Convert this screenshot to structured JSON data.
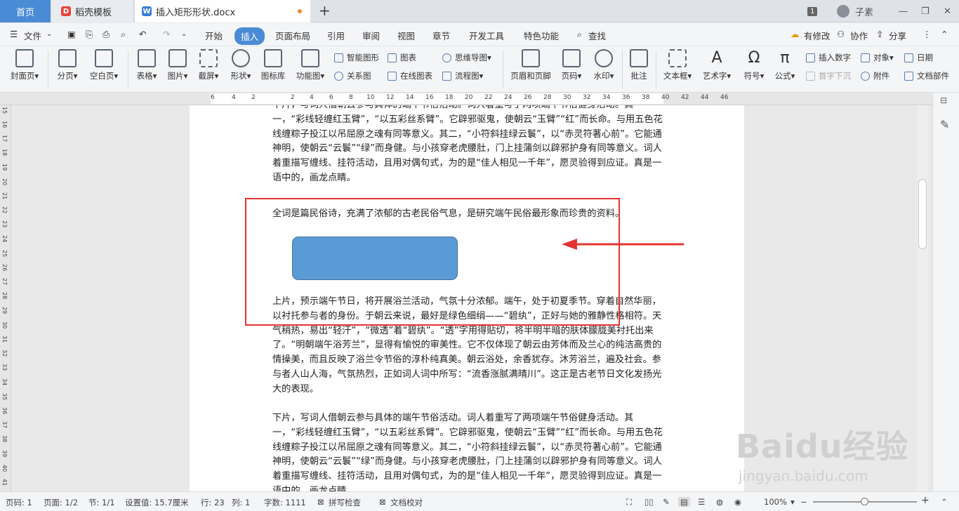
{
  "tabs": {
    "home": "首页",
    "template": "稻壳模板",
    "doc": "插入矩形形状.docx",
    "new": "+"
  },
  "window": {
    "badge": "1",
    "user": "子素"
  },
  "menu": {
    "file": "文件",
    "items": [
      "开始",
      "插入",
      "页面布局",
      "引用",
      "审阅",
      "视图",
      "章节",
      "开发工具",
      "特色功能"
    ],
    "search": "查找",
    "right": [
      "有修改",
      "协作",
      "分享"
    ]
  },
  "ribbon": {
    "cover": "封面页",
    "pagebreak": "分页",
    "blank": "空白页",
    "table": "表格",
    "picture": "图片",
    "screenshot": "截屏",
    "shape": "形状",
    "iconlib": "图标库",
    "funcchart": "功能图",
    "smartart": "智能图形",
    "chart": "图表",
    "mindmap": "思维导图",
    "relation": "关系图",
    "onlinechart": "在线图表",
    "flowchart": "流程图",
    "headerfooter": "页眉和页脚",
    "pagenum": "页码",
    "watermark": "水印",
    "comment": "批注",
    "textbox": "文本框",
    "wordart": "艺术字",
    "symbol": "符号",
    "formula": "公式",
    "insertnum": "插入数字",
    "object": "对象",
    "date": "日期",
    "dropcap": "首字下沉",
    "attachment": "附件",
    "docpart": "文档部件"
  },
  "ruler": {
    "h": [
      "6",
      "4",
      "2",
      "2",
      "4",
      "6",
      "8",
      "10",
      "12",
      "14",
      "16",
      "18",
      "20",
      "22",
      "24",
      "26",
      "28",
      "30",
      "32",
      "34",
      "36",
      "38",
      "40",
      "42",
      "44",
      "46"
    ],
    "v": [
      "15",
      "16",
      "17",
      "18",
      "19",
      "20",
      "21",
      "22",
      "23",
      "24",
      "25",
      "26",
      "27",
      "28",
      "29",
      "30",
      "31",
      "32",
      "33",
      "34",
      "35",
      "36",
      "37",
      "38",
      "39",
      "40",
      "41"
    ]
  },
  "doc": {
    "p0": "下片，写词人借朝云参与具体的端午节俗活动。词人着重写了两项端午节俗健身活动。其一，“彩线轻缠红玉臂”，“以五彩丝系臂”。它辟邪驱鬼，使朝云“玉臂”“红”而长命。与用五色花线缠粽子投江以吊屈原之魂有同等意义。其二，“小符斜挂绿云鬟”，以“赤灵符著心前”。它能通神明，使朝云“云鬟”“绿”而身健。与小孩穿老虎腰肚，门上挂蒲剑以辟邪护身有同等意义。词人着重描写缠线、挂符活动，且用对偶句式，为的是“佳人相见一千年”，愿灵验得到应证。真是一语中的，画龙点睛。",
    "p1": "全词是篇民俗诗，充满了浓郁的古老民俗气息，是研究端午民俗最形象而珍贵的资料。",
    "p2": "上片，预示端午节日，将开展浴兰活动，气氛十分浓郁。端午，处于初夏季节。穿着自然华丽，以衬托参与者的身份。于朝云来说，最好是绿色细绢——“碧纨”，正好与她的雅静性格相符。天气稍热，易出“轻汗”，“微透”着“碧纨”。“透”字用得贴切，将半明半暗的肤体朦胧美衬托出来了。“明朝端午浴芳兰”，显得有愉悦的审美性。它不仅体现了朝云由芳体而及兰心的纯洁高贵的情操美，而且反映了浴兰令节俗的淳朴纯真美。朝云浴处，余香犹存。沐芳浴兰，遍及社会。参与者人山人海，气氛热烈，正如词人词中所写：“流香涨腻满晴川”。这正是古老节日文化发扬光大的表现。",
    "p3": "下片，写词人借朝云参与具体的端午节俗活动。词人着重写了两项端午节俗健身活动。其一，“彩线轻缠红玉臂”，“以五彩丝系臂”。它辟邪驱鬼，使朝云“玉臂”“红”而长命。与用五色花线缠粽子投江以吊屈原之魂有同等意义。其二，“小符斜挂绿云鬟”，以“赤灵符著心前”。它能通神明，使朝云“云鬟”“绿”而身健。与小孩穿老虎腰肚，门上挂蒲剑以辟邪护身有同等意义。词人着重描写缠线、挂符活动，且用对偶句式，为的是“佳人相见一千年”，愿灵验得到应证。真是一语中的，画龙点睛。"
  },
  "status": {
    "page": "页码: 1",
    "pages": "页面: 1/2",
    "section": "节: 1/1",
    "setting": "设置值: 15.7厘米",
    "row": "行: 23",
    "col": "列: 1",
    "words": "字数: 1111",
    "spell": "拼写检查",
    "proof": "文档校对",
    "zoom": "100%"
  },
  "watermark": {
    "brand": "Baidu经验",
    "url": "jingyan.baidu.com"
  },
  "colors": {
    "accent": "#4a8bd6",
    "shape_fill": "#5b9bd5",
    "highlight": "#e53333"
  }
}
